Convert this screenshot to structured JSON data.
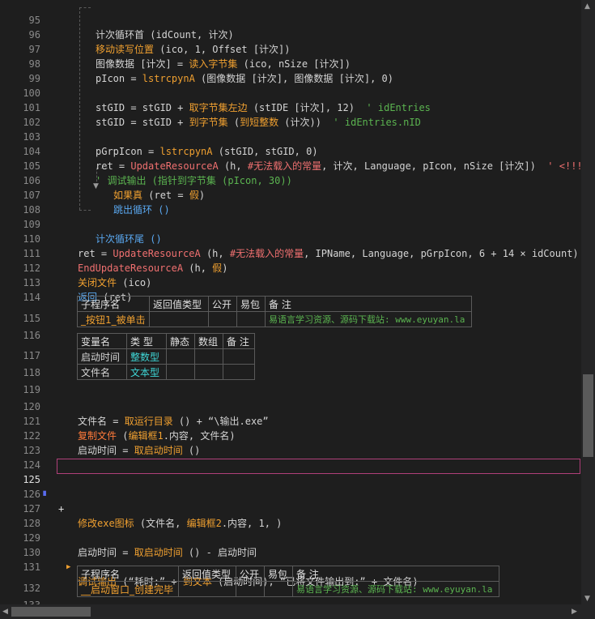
{
  "lines": {
    "l95": {
      "n": "95",
      "code": "计次循环首 (idCount, 计次)"
    },
    "l96": {
      "n": "96",
      "a": "移动读写位置",
      "b": " (ico, 1, Offset [计次])"
    },
    "l97": {
      "n": "97",
      "a": "图像数据 [计次] = ",
      "b": "读入字节集",
      "c": " (ico, nSize [计次])"
    },
    "l98": {
      "n": "98",
      "a": "pIcon = ",
      "b": "lstrcpynA",
      "c": " (图像数据 [计次], 图像数据 [计次], 0)"
    },
    "l99": {
      "n": "99"
    },
    "l100": {
      "n": "100",
      "a": "stGID = stGID + ",
      "b": "取字节集左边",
      "c": " (stIDE [计次], 12)",
      "d": "  ' idEntries"
    },
    "l101": {
      "n": "101",
      "a": "stGID = stGID + ",
      "b": "到字节集",
      "c": " (",
      "d": "到短整数",
      "e": " (计次))",
      "f": "  ' idEntries.nID"
    },
    "l102": {
      "n": "102"
    },
    "l103": {
      "n": "103",
      "a": "pGrpIcon = ",
      "b": "lstrcpynA",
      "c": " (stGID, stGID, 0)"
    },
    "l104": {
      "n": "104",
      "a": "ret = ",
      "b": "UpdateResourceA",
      "c": " (h, ",
      "d": "#无法载入的常量",
      "e": ", 计次, Language, pIcon, nSize [计次])",
      "f": "  ' <!!!>"
    },
    "l105": {
      "n": "105",
      "code": "' 调试输出 (指针到字节集 (pIcon, 30))"
    },
    "l106": {
      "n": "106",
      "a": "如果真",
      "b": " (ret = ",
      "c": "假",
      "d": ")"
    },
    "l107": {
      "n": "107",
      "code": "跳出循环 ()"
    },
    "l108": {
      "n": "108"
    },
    "l109": {
      "n": "109",
      "code": "计次循环尾 ()"
    },
    "l110": {
      "n": "110",
      "a": "ret = ",
      "b": "UpdateResourceA",
      "c": " (h, ",
      "d": "#无法载入的常量",
      "e": ", IPName, Language, pGrpIcon, 6 + 14 × idCount)",
      "f": "  ' <!!!>"
    },
    "l111": {
      "n": "111",
      "a": "EndUpdateResourceA",
      "b": " (h, ",
      "c": "假",
      "d": ")"
    },
    "l112": {
      "n": "112",
      "a": "关闭文件",
      "b": " (ico)"
    },
    "l113": {
      "n": "113",
      "a": "返回",
      "b": " (ret)"
    },
    "l114": {
      "n": "114"
    },
    "l115": {
      "n": "115"
    },
    "l116": {
      "n": "116"
    },
    "l117": {
      "n": "117"
    },
    "l118": {
      "n": "118"
    },
    "l119": {
      "n": "119"
    },
    "l120": {
      "n": "120",
      "a": "文件名 = ",
      "b": "取运行目录",
      "c": " () + “\\输出.exe”"
    },
    "l121": {
      "n": "121",
      "a": "复制文件",
      "b": " (",
      "c": "编辑框1",
      "d": ".内容, 文件名)"
    },
    "l122": {
      "n": "122",
      "a": "启动时间 = ",
      "b": "取启动时间",
      "c": " ()"
    },
    "l123": {
      "n": "123"
    },
    "l124": {
      "n": "124"
    },
    "l125": {
      "n": "125",
      "plus": "+",
      "a": "修改exe图标",
      "b": " (文件名, ",
      "c": "编辑框2",
      "d": ".内容, 1, )"
    },
    "l126": {
      "n": "126"
    },
    "l127": {
      "n": "127"
    },
    "l128": {
      "n": "128"
    },
    "l129": {
      "n": "129",
      "a": "启动时间 = ",
      "b": "取启动时间",
      "c": " () - 启动时间"
    },
    "l130": {
      "n": "130",
      "a": "调试输出",
      "b": " (“耗时:” + ",
      "c": "到文本",
      "d": " (启动时间), “已将文件输出到:” + 文件名)"
    },
    "l131": {
      "n": "131"
    },
    "l132": {
      "n": "132"
    },
    "l133": {
      "n": "133"
    }
  },
  "sub1": {
    "headers": [
      "子程序名",
      "返回值类型",
      "公开",
      "易包",
      "备 注"
    ],
    "name": "_按钮1_被单击",
    "note": "易语言学习资源、源码下载站: www.eyuyan.la"
  },
  "vars1": {
    "headers": [
      "变量名",
      "类 型",
      "静态",
      "数组",
      "备 注"
    ],
    "rows": [
      {
        "name": "启动时间",
        "type": "整数型"
      },
      {
        "name": "文件名",
        "type": "文本型"
      }
    ]
  },
  "sub2": {
    "headers": [
      "子程序名",
      "返回值类型",
      "公开",
      "易包",
      "备 注"
    ],
    "name": "__启动窗口_创建完毕",
    "note": "易语言学习资源、源码下载站: www.eyuyan.la"
  },
  "marker125": "∎",
  "colors": {
    "background": "#1e1e1e",
    "keyword": "#f0a030",
    "function": "#f07070",
    "comment": "#5bb450",
    "type": "#3fd6d6",
    "highlight": "#b0407a"
  }
}
